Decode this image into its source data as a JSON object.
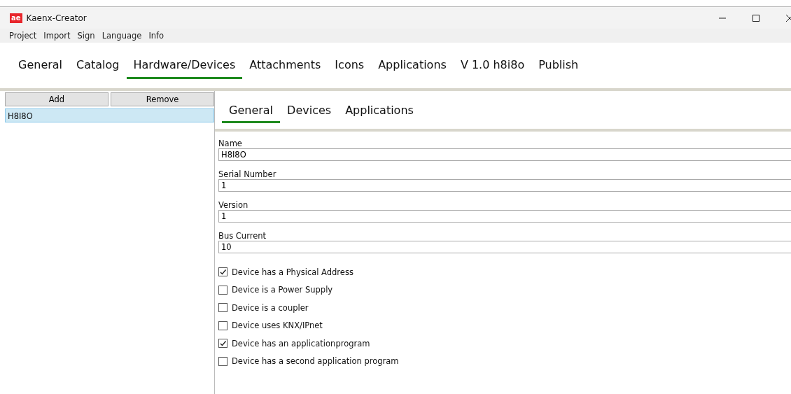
{
  "window": {
    "title": "Kaenx-Creator",
    "logo": "ae"
  },
  "menu": [
    "Project",
    "Import",
    "Sign",
    "Language",
    "Info"
  ],
  "tabs": [
    {
      "label": "General",
      "selected": false
    },
    {
      "label": "Catalog",
      "selected": false
    },
    {
      "label": "Hardware/Devices",
      "selected": true
    },
    {
      "label": "Attachments",
      "selected": false
    },
    {
      "label": "Icons",
      "selected": false
    },
    {
      "label": "Applications",
      "selected": false
    },
    {
      "label": "V 1.0 h8i8o",
      "selected": false
    },
    {
      "label": "Publish",
      "selected": false
    }
  ],
  "sidebar": {
    "buttons": [
      "Add",
      "Remove"
    ],
    "items": [
      {
        "label": "H8I8O",
        "selected": true
      }
    ]
  },
  "subtabs": [
    {
      "label": "General",
      "selected": true
    },
    {
      "label": "Devices",
      "selected": false
    },
    {
      "label": "Applications",
      "selected": false
    }
  ],
  "fields": [
    {
      "label": "Name",
      "value": "H8I8O"
    },
    {
      "label": "Serial Number",
      "value": "1"
    },
    {
      "label": "Version",
      "value": "1"
    },
    {
      "label": "Bus Current",
      "value": "10"
    }
  ],
  "checkboxes": [
    {
      "label": "Device has a Physical Address",
      "checked": true
    },
    {
      "label": "Device is a Power Supply",
      "checked": false
    },
    {
      "label": "Device is a coupler",
      "checked": false
    },
    {
      "label": "Device uses KNX/IPnet",
      "checked": false
    },
    {
      "label": "Device has an applicationprogram",
      "checked": true
    },
    {
      "label": "Device has a second application program",
      "checked": false
    }
  ]
}
